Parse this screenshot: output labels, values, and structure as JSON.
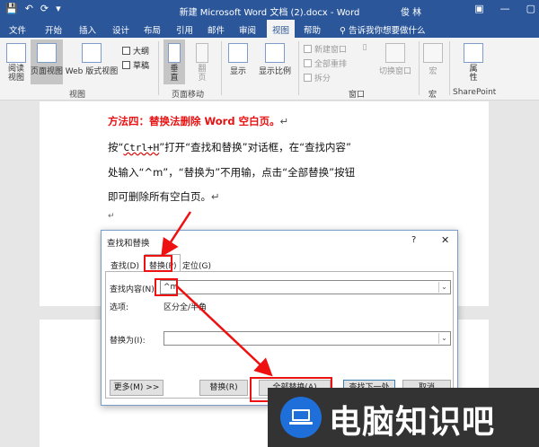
{
  "window": {
    "title": "新建 Microsoft Word 文档 (2).docx - Word",
    "user": "俊 林",
    "quick_access": [
      "💾",
      "↶",
      "⟳",
      "▾"
    ]
  },
  "tabs": [
    "文件",
    "开始",
    "插入",
    "设计",
    "布局",
    "引用",
    "邮件",
    "审阅",
    "视图",
    "帮助"
  ],
  "active_tab": "视图",
  "tell_me": "告诉我你想要做什么",
  "ribbon": {
    "views": {
      "read": "阅读\n视图",
      "print": "页面视图",
      "web": "Web 版式视图",
      "outline": "大纲",
      "draft": "草稿",
      "group": "视图"
    },
    "page_move": {
      "vertical": "垂直",
      "side": "翻\n页",
      "group": "页面移动"
    },
    "show": "显示",
    "zoom": "显示比例",
    "window": {
      "new": "新建窗口",
      "arrange": "全部重排",
      "split": "拆分",
      "switch": "切换窗口",
      "group": "窗口"
    },
    "macro": {
      "label": "宏",
      "group": "宏"
    },
    "sharepoint": {
      "label": "属\n性",
      "group": "SharePoint"
    }
  },
  "document": {
    "heading": "方法四：替换法删除 Word 空白页。",
    "line1_a": "按“",
    "line1_kbd": "Ctrl+H",
    "line1_b": "”打开“查找和替换”对话框，在“查找内容”",
    "line2": "处输入“^m”，“替换为”不用输，点击“全部替换”按钮",
    "line3": "即可删除所有空白页。",
    "para_mark": "↵"
  },
  "dialog": {
    "title": "查找和替换",
    "help": "?",
    "close": "✕",
    "tabs": [
      "查找(D)",
      "替换(P)",
      "定位(G)"
    ],
    "find_label": "查找内容(N):",
    "find_value": "^m",
    "options_label": "选项:",
    "options_value": "区分全/半角",
    "replace_label": "替换为(I):",
    "replace_value": "",
    "more": "更多(M) >>",
    "replace_btn": "替换(R)",
    "replace_all_btn": "全部替换(A)",
    "find_next_btn": "查找下一处(F)",
    "cancel_btn": "取消"
  },
  "watermark": {
    "text": "电脑知识吧"
  },
  "colors": {
    "word_blue": "#2b579a",
    "heading_red": "#e81212",
    "highlight_red": "#e11"
  }
}
